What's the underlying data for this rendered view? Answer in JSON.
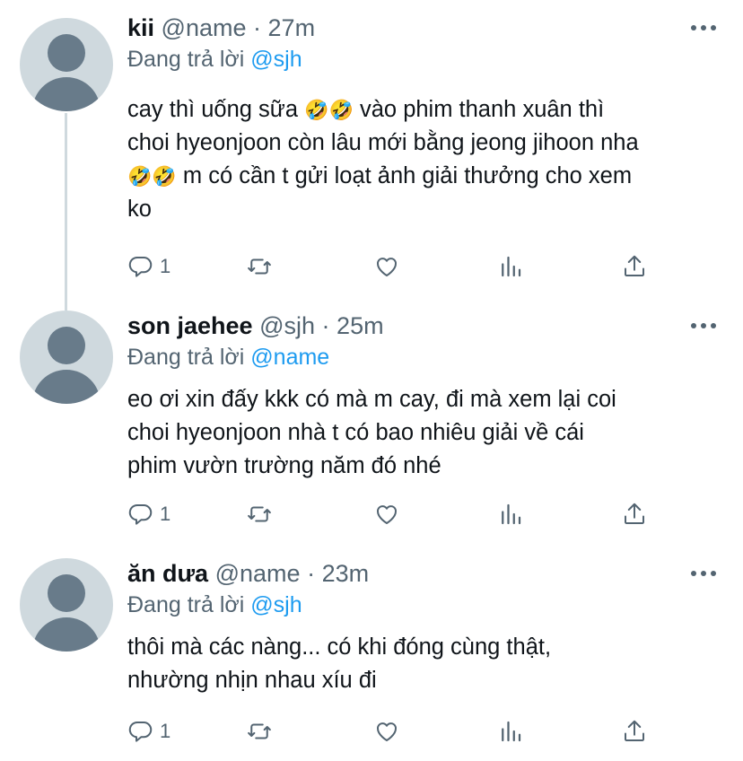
{
  "tweets": [
    {
      "name": "kii",
      "handle": "@name",
      "time": "27m",
      "reply_prefix": "Đang trả lời",
      "reply_handle": "@sjh",
      "lines": [
        [
          "cay thì uống sữa ",
          "🤣🤣",
          "  vào phim thanh xuân thì"
        ],
        [
          "choi hyeonjoon còn lâu mới bằng jeong jihoon nha",
          "",
          ""
        ],
        [
          "",
          "🤣🤣",
          "  m có cần t gửi loạt ảnh giải thưởng cho xem"
        ],
        [
          "ko",
          "",
          ""
        ]
      ],
      "reply_count": "1"
    },
    {
      "name": "son jaehee",
      "handle": "@sjh",
      "time": "25m",
      "reply_prefix": "Đang trả lời",
      "reply_handle": "@name",
      "lines": [
        [
          "eo ơi xin đấy kkk có mà m cay, đi mà xem lại coi",
          "",
          ""
        ],
        [
          "choi hyeonjoon nhà t có bao nhiêu giải về cái",
          "",
          ""
        ],
        [
          "phim vườn trường năm đó nhé",
          "",
          ""
        ]
      ],
      "reply_count": "1"
    },
    {
      "name": "ăn dưa",
      "handle": "@name",
      "time": "23m",
      "reply_prefix": "Đang trả lời",
      "reply_handle": "@sjh",
      "lines": [
        [
          "thôi mà các nàng... có khi đóng cùng thật,",
          "",
          ""
        ],
        [
          "nhường nhịn nhau xíu đi",
          "",
          ""
        ]
      ],
      "reply_count": "1"
    }
  ],
  "separator": "·",
  "icons": {
    "reply": "reply-icon",
    "retweet": "retweet-icon",
    "like": "heart-icon",
    "analytics": "analytics-icon",
    "share": "share-icon",
    "more": "more-icon"
  },
  "colors": {
    "text": "#0f1419",
    "secondary": "#536471",
    "link": "#1d9bf0",
    "avatar_bg": "#cfd9de",
    "avatar_fg": "#687b8a"
  }
}
